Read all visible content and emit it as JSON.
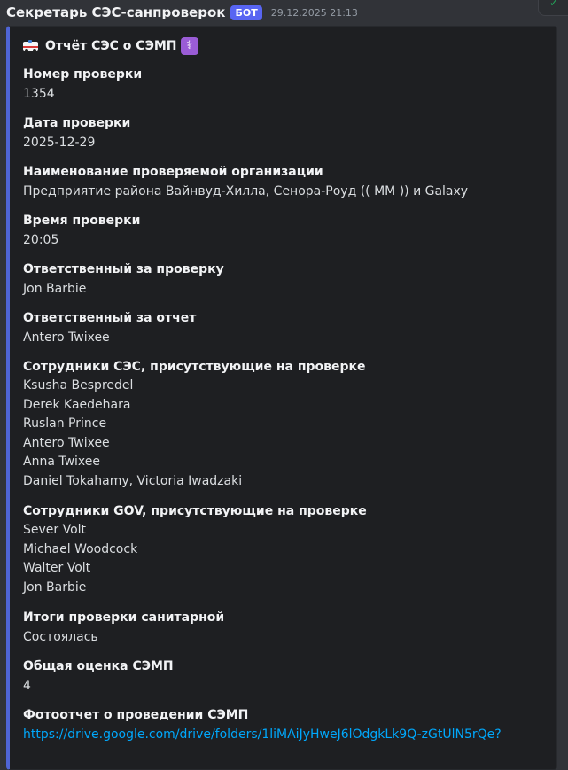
{
  "message": {
    "author": "Секретарь СЭС-санпроверок",
    "bot_badge": "БОТ",
    "timestamp": "29.12.2025 21:13"
  },
  "embed": {
    "title_text": "Отчёт СЭС о СЭМП",
    "title_emoji_left": "ambulance-emoji",
    "title_emoji_right": "medical-symbol-emoji",
    "accent_color": "#4f65d6",
    "fields": [
      {
        "name": "Номер проверки",
        "value": "1354"
      },
      {
        "name": "Дата проверки",
        "value": "2025-12-29"
      },
      {
        "name": "Наименование проверяемой организации",
        "value": "Предприятие района Вайнвуд-Хилла, Сенора-Роуд (( ММ )) и Galaxy"
      },
      {
        "name": "Время проверки",
        "value": "20:05"
      },
      {
        "name": "Ответственный за проверку",
        "value": "Jon Barbie"
      },
      {
        "name": "Ответственный за отчет",
        "value": "Antero Twixee"
      },
      {
        "name": "Сотрудники СЭС, присутствующие на проверке",
        "values": [
          "Ksusha Bespredel",
          "Derek Kaedehara",
          "Ruslan Prince",
          "Antero Twixee",
          "Anna Twixee",
          "Daniel Tokahamy, Victoria Iwadzaki"
        ]
      },
      {
        "name": "Сотрудники GOV, присутствующие на проверке",
        "values": [
          "Sever Volt",
          "Michael Woodcock",
          "Walter Volt",
          "Jon Barbie"
        ]
      },
      {
        "name": "Итоги проверки санитарной",
        "value": "Состоялась"
      },
      {
        "name": "Общая оценка СЭМП",
        "value": "4"
      },
      {
        "name": "Фотоотчет о проведении СЭМП",
        "value": "https://drive.google.com/drive/folders/1liMAiJyHweJ6lOdgkLk9Q-zGtUlN5rQe?"
      }
    ]
  }
}
